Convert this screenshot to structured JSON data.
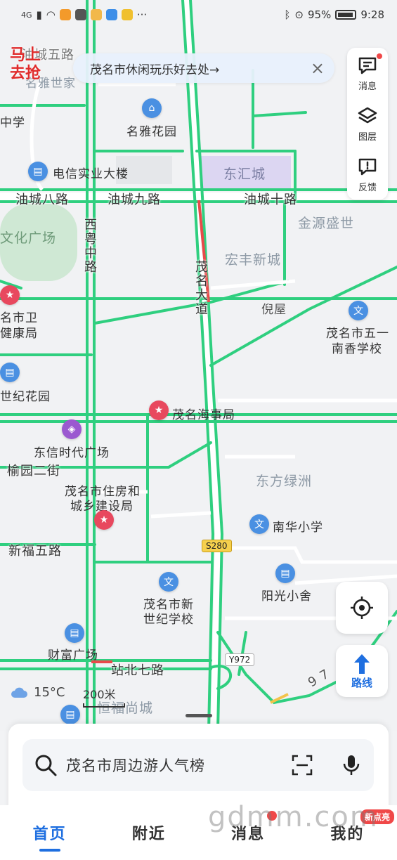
{
  "status_bar": {
    "network": "4G",
    "battery": "95%",
    "time": "9:28",
    "more": "···"
  },
  "promo": {
    "line1": "马上",
    "line2": "去抢"
  },
  "banner": {
    "text": "茂名市休闲玩乐好去处→",
    "close": "×"
  },
  "toolbar": {
    "message": "消息",
    "layers": "图层",
    "feedback": "反馈"
  },
  "map": {
    "roads": {
      "youcheng8": "油城八路",
      "youcheng9": "油城九路",
      "youcheng10": "油城十路",
      "xiyue": "西粤中路",
      "maoming_avenue": "茂名大道",
      "yuyuan2": "榆园二街",
      "xinfu5": "新福五路",
      "zhanbei7": "站北七路",
      "shield_s280": "S280",
      "shield_y972": "Y972",
      "wuyu_top": "油城五路",
      "road_97": "9 7"
    },
    "pois": {
      "zhongxue": "中学",
      "mingya": "名雅花园",
      "dianxin": "电信实业大楼",
      "donghui": "东汇城",
      "jinyuan": "金源盛世",
      "hongfeng": "宏丰新城",
      "wenhua": "文化广场",
      "niwu": "倪屋",
      "wuyi_line1": "茂名市五一",
      "wuyi_line2": "南香学校",
      "weijian_line1": "名市卫",
      "weijian_line2": "健康局",
      "shiji": "世纪花园",
      "haishi": "茂名海事局",
      "dongxin": "东信时代广场",
      "zhufang_line1": "茂名市住房和",
      "zhufang_line2": "城乡建设局",
      "dongfang": "东方绿洲",
      "nanhua": "南华小学",
      "yangguang": "阳光小舍",
      "xinshiji_line1": "茂名市新",
      "xinshiji_line2": "世纪学校",
      "caifu": "财富广场",
      "hengfu": "恒福尚城",
      "mingyashiji": "名雅世家"
    }
  },
  "weather": {
    "temp": "15°C"
  },
  "scale": {
    "label": "200米"
  },
  "route_button": "路线",
  "search": {
    "placeholder": "茂名市周边游人气榜"
  },
  "tabs": [
    {
      "label": "首页",
      "active": true
    },
    {
      "label": "附近",
      "active": false
    },
    {
      "label": "消息",
      "active": false
    },
    {
      "label": "我的",
      "active": false
    }
  ],
  "tab_badge": "新点亮",
  "watermark": "gdmm.com"
}
